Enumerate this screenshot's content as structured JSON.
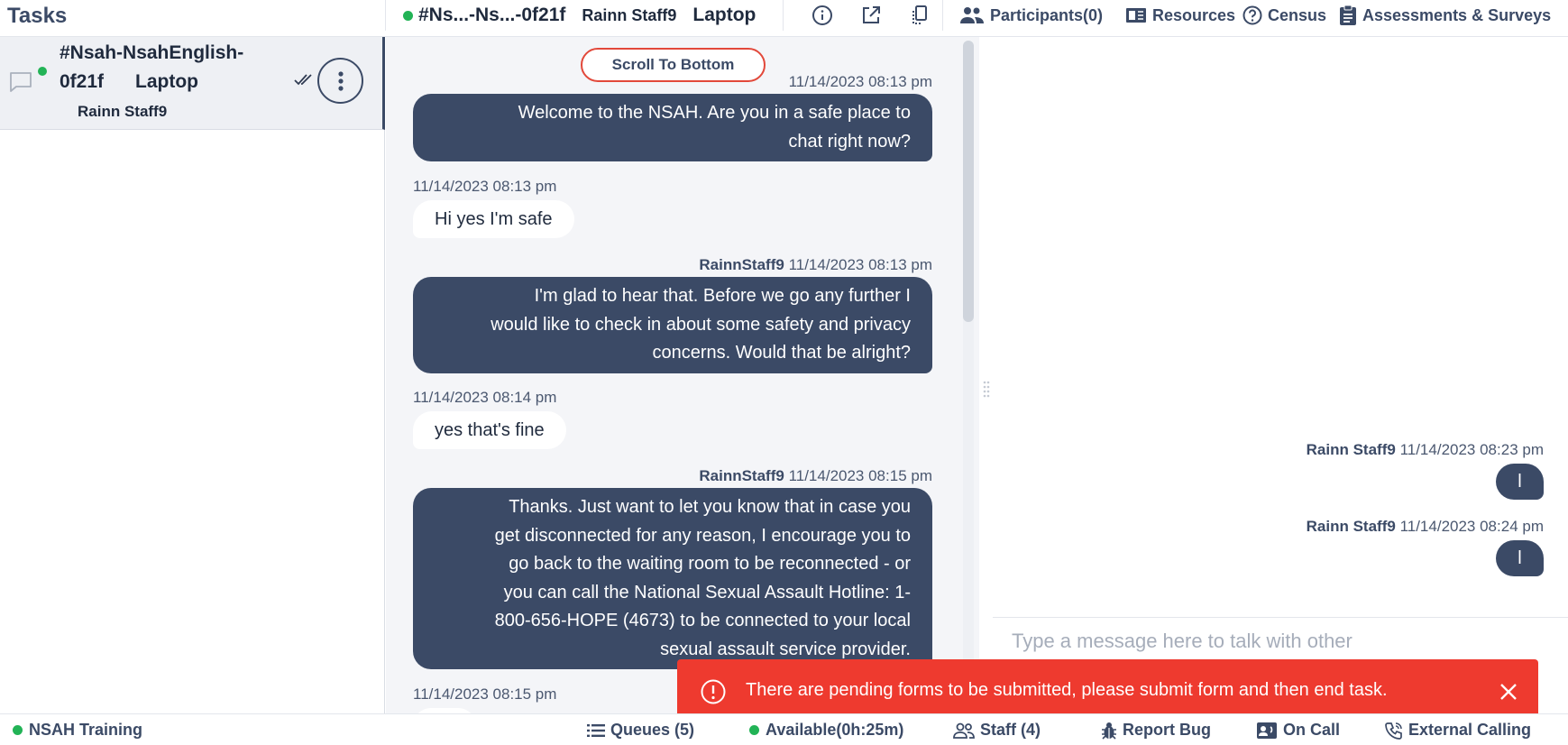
{
  "header": {
    "tasks_title": "Tasks",
    "conversation_id": "#Ns...-Ns...-0f21f",
    "staff_name": "Rainn Staff9",
    "device": "Laptop",
    "participants_label": "Participants(0)",
    "resources_label": "Resources",
    "census_label": "Census",
    "assessments_label": "Assessments & Surveys",
    "icons": [
      "info-icon",
      "open-external-icon",
      "copy-icon",
      "people-icon",
      "book-icon",
      "help-circle-icon",
      "clipboard-icon"
    ]
  },
  "task_list": {
    "items": [
      {
        "title_line1": "#Nsah-NsahEnglish-",
        "title_line2": "0f21f",
        "device": "Laptop",
        "staff": "Rainn Staff9",
        "status_color": "#22b356"
      }
    ]
  },
  "chat": {
    "scroll_button": "Scroll To Bottom",
    "messages": [
      {
        "direction": "out",
        "sender": "",
        "time": "11/14/2023 08:13 pm",
        "lines": [
          "Welcome to the NSAH. Are you in a safe place to",
          "chat right now?"
        ]
      },
      {
        "direction": "in",
        "sender": "",
        "time": "11/14/2023 08:13 pm",
        "lines": [
          "Hi yes I'm safe"
        ]
      },
      {
        "direction": "out",
        "sender": "RainnStaff9",
        "time": "11/14/2023 08:13 pm",
        "lines": [
          "I'm glad to hear that. Before we go any further I",
          "would like to check in about some safety and privacy",
          "concerns. Would that be alright?"
        ]
      },
      {
        "direction": "in",
        "sender": "",
        "time": "11/14/2023 08:14 pm",
        "lines": [
          "yes that's fine"
        ]
      },
      {
        "direction": "out",
        "sender": "RainnStaff9",
        "time": "11/14/2023 08:15 pm",
        "lines": [
          "Thanks. Just want to let you know that in case you",
          "get disconnected for any reason, I encourage you to",
          "go back to the waiting room to be reconnected - or",
          "you can call the National Sexual Assault Hotline: 1-",
          "800-656-HOPE (4673) to be connected to your local",
          "sexual assault service provider."
        ]
      },
      {
        "direction": "in",
        "sender": "",
        "time": "11/14/2023 08:15 pm",
        "lines": [
          ""
        ]
      }
    ]
  },
  "staff_chat": {
    "messages": [
      {
        "sender": "Rainn Staff9",
        "time": "11/14/2023 08:23 pm",
        "text": "l"
      },
      {
        "sender": "Rainn Staff9",
        "time": "11/14/2023 08:24 pm",
        "text": "l"
      }
    ],
    "input_placeholder": "Type a message here to talk with other"
  },
  "toast": {
    "message": "There are pending forms to be submitted, please submit form and then end task.",
    "color": "#ee3a2f"
  },
  "footer": {
    "training_label": "NSAH Training",
    "queues_label": "Queues (5)",
    "available_label": "Available(0h:25m)",
    "staff_label": "Staff (4)",
    "report_bug_label": "Report Bug",
    "on_call_label": "On Call",
    "external_calling_label": "External Calling"
  },
  "colors": {
    "primary": "#3b4a66",
    "online": "#22b356",
    "alert": "#ee3a2f"
  }
}
